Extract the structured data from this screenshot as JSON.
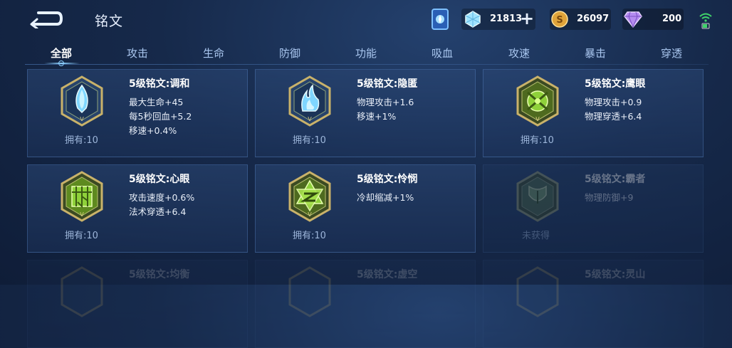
{
  "header": {
    "title": "铭文",
    "resources": [
      {
        "icon": "diamond-icon",
        "value": "21813"
      },
      {
        "icon": "gold-coin-icon",
        "value": "26097"
      },
      {
        "icon": "purple-crystal-icon",
        "value": "200"
      }
    ],
    "add_symbol": "+"
  },
  "tabs": [
    {
      "label": "全部",
      "active": true
    },
    {
      "label": "攻击"
    },
    {
      "label": "生命"
    },
    {
      "label": "防御"
    },
    {
      "label": "功能"
    },
    {
      "label": "吸血"
    },
    {
      "label": "攻速"
    },
    {
      "label": "暴击"
    },
    {
      "label": "穿透"
    }
  ],
  "runes": [
    {
      "name": "5级铭文:调和",
      "stats": [
        "最大生命+45",
        "每5秒回血+5.2",
        "移速+0.4%"
      ],
      "owned": "拥有:10",
      "color": "blue"
    },
    {
      "name": "5级铭文:隐匿",
      "stats": [
        "物理攻击+1.6",
        "移速+1%"
      ],
      "owned": "拥有:10",
      "color": "blue"
    },
    {
      "name": "5级铭文:鹰眼",
      "stats": [
        "物理攻击+0.9",
        "物理穿透+6.4"
      ],
      "owned": "拥有:10",
      "color": "green"
    },
    {
      "name": "5级铭文:心眼",
      "stats": [
        "攻击速度+0.6%",
        "法术穿透+6.4"
      ],
      "owned": "拥有:10",
      "color": "green"
    },
    {
      "name": "5级铭文:怜悯",
      "stats": [
        "冷却缩减+1%"
      ],
      "owned": "拥有:10",
      "color": "green"
    },
    {
      "name": "5级铭文:霸者",
      "stats": [
        "物理防御+9"
      ],
      "owned": "未获得",
      "color": "green"
    },
    {
      "name": "5级铭文:均衡",
      "stats": [],
      "owned": "",
      "color": "blue"
    },
    {
      "name": "5级铭文:虚空",
      "stats": [],
      "owned": "",
      "color": "blue"
    },
    {
      "name": "5级铭文:灵山",
      "stats": [],
      "owned": "",
      "color": "blue"
    }
  ],
  "colors": {
    "blue_gem": "#7fd6ff",
    "green_gem": "#8fd13a",
    "gold_frame": "#c9b26a"
  }
}
